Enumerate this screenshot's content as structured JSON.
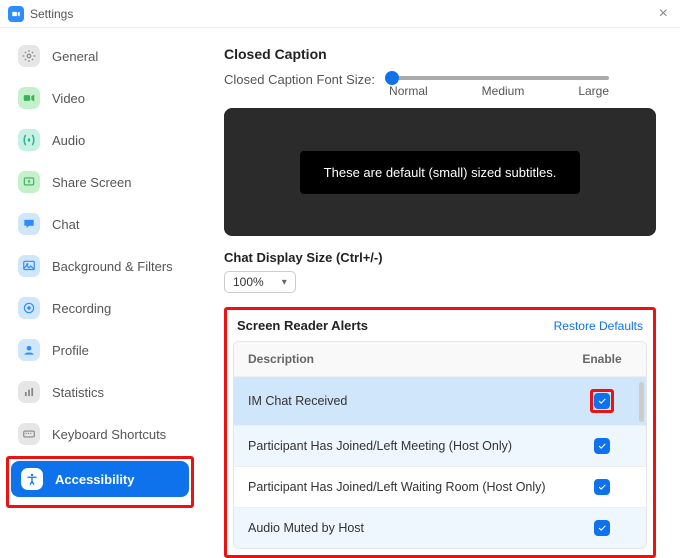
{
  "window": {
    "title": "Settings"
  },
  "sidebar": {
    "items": [
      {
        "label": "General",
        "color": "#e6e6e6",
        "svg": "gear"
      },
      {
        "label": "Video",
        "color": "#c5f0cc",
        "svg": "video"
      },
      {
        "label": "Audio",
        "color": "#c6f1e3",
        "svg": "audio"
      },
      {
        "label": "Share Screen",
        "color": "#c5f0cc",
        "svg": "share"
      },
      {
        "label": "Chat",
        "color": "#cfe6fb",
        "svg": "chat"
      },
      {
        "label": "Background & Filters",
        "color": "#cfe6fb",
        "svg": "bg"
      },
      {
        "label": "Recording",
        "color": "#cfe6fb",
        "svg": "rec"
      },
      {
        "label": "Profile",
        "color": "#cfe6fb",
        "svg": "user"
      },
      {
        "label": "Statistics",
        "color": "#e6e6e6",
        "svg": "stats"
      },
      {
        "label": "Keyboard Shortcuts",
        "color": "#e6e6e6",
        "svg": "kbd"
      },
      {
        "label": "Accessibility",
        "color": "#0e72ed",
        "svg": "access",
        "active": true
      }
    ]
  },
  "cc": {
    "title": "Closed Caption",
    "font_size_label": "Closed Caption Font Size:",
    "marks": [
      "Normal",
      "Medium",
      "Large"
    ],
    "preview_text": "These are default (small) sized subtitles."
  },
  "chat": {
    "title": "Chat Display Size (Ctrl+/-)",
    "value": "100%"
  },
  "alerts": {
    "title": "Screen Reader Alerts",
    "restore": "Restore Defaults",
    "col_desc": "Description",
    "col_enable": "Enable",
    "rows": [
      {
        "desc": "IM Chat Received",
        "enabled": true,
        "highlight": "sel"
      },
      {
        "desc": "Participant Has Joined/Left Meeting (Host Only)",
        "enabled": true,
        "highlight": "alt"
      },
      {
        "desc": "Participant Has Joined/Left Waiting Room (Host Only)",
        "enabled": true
      },
      {
        "desc": "Audio Muted by Host",
        "enabled": true,
        "highlight": "alt"
      }
    ]
  }
}
